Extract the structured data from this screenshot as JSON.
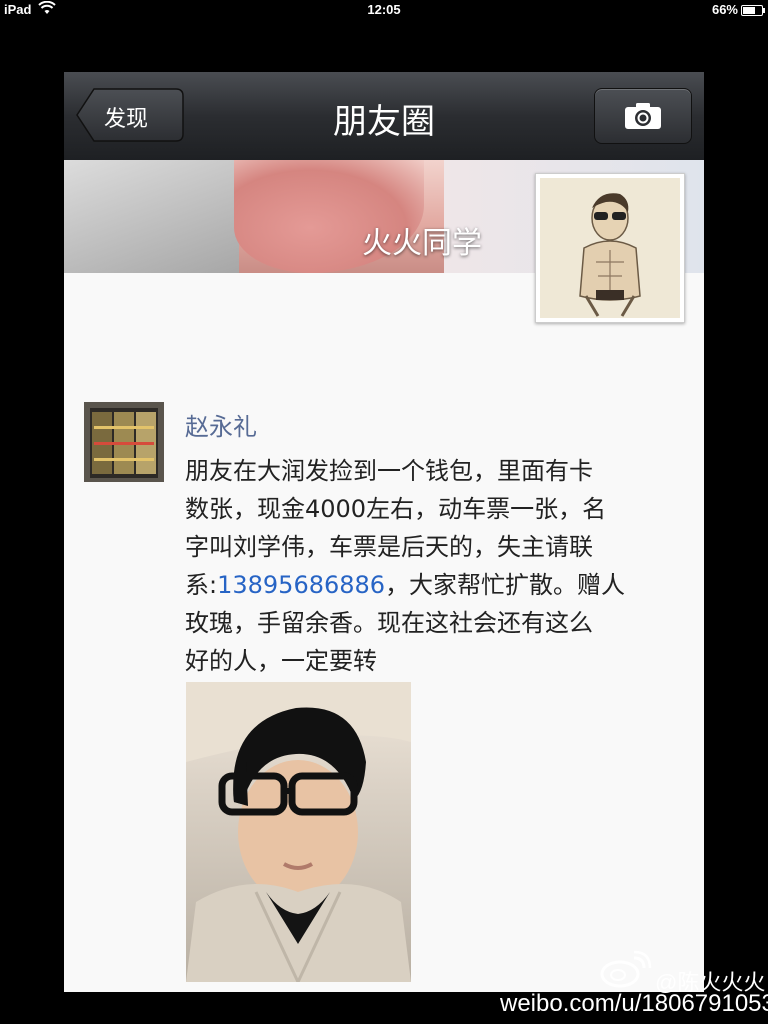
{
  "status_bar": {
    "device": "iPad",
    "time": "12:05",
    "battery": "66%",
    "battery_level": 0.66
  },
  "nav": {
    "back_label": "发现",
    "title": "朋友圈",
    "camera_icon": "camera-icon"
  },
  "profile": {
    "cover_name": "火火同学"
  },
  "post": {
    "author": "赵永礼",
    "text_lines": [
      "朋友在大润发捡到一个钱包，里面有卡",
      "数张，现金4000左右，动车票一张，名",
      "字叫刘学伟，车票是后天的，失主请联"
    ],
    "text_before_phone": "系:",
    "phone": "13895686886",
    "text_after_phone": "，大家帮忙扩散。赠人",
    "text_lines_end": [
      "玫瑰，手留余香。现在这社会还有这么",
      "好的人，一定要转"
    ]
  },
  "watermark": {
    "handle": "@陈火火火",
    "url": "weibo.com/u/1806791053"
  },
  "colors": {
    "author": "#576b95",
    "link": "#2764c5",
    "navbar": "#2b2d31"
  }
}
